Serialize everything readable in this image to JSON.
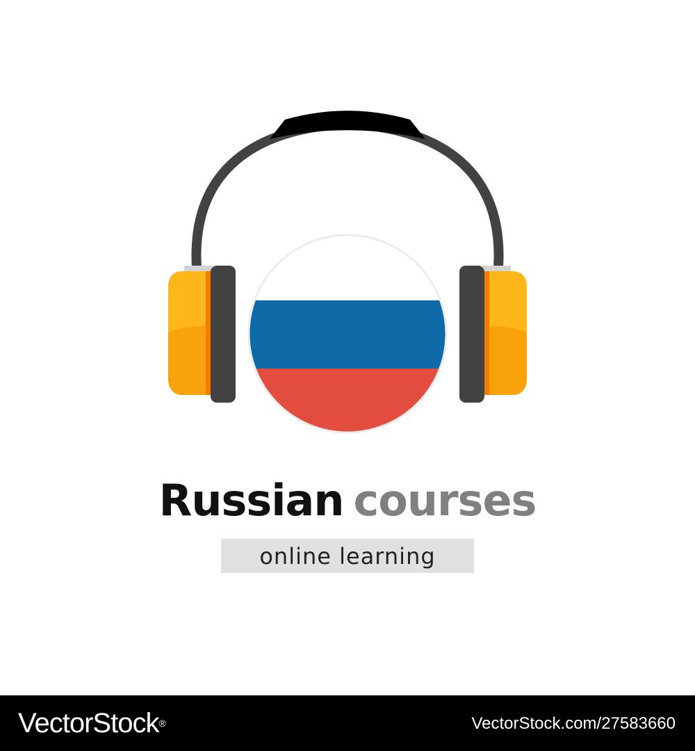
{
  "logo": {
    "icon": "headphones-with-russian-flag-icon",
    "flag_colors": [
      "#ffffff",
      "#0f6aa8",
      "#e34d3f"
    ],
    "earcup_colors": [
      "#fdb71b",
      "#f9a20c",
      "#424242"
    ]
  },
  "headline": {
    "word_primary": "Russian",
    "word_secondary": "courses"
  },
  "subtitle": {
    "text": "online learning"
  },
  "footer": {
    "brand": "VectorStock",
    "brand_mark": "®",
    "image_ref": "VectorStock.com/27583660"
  }
}
